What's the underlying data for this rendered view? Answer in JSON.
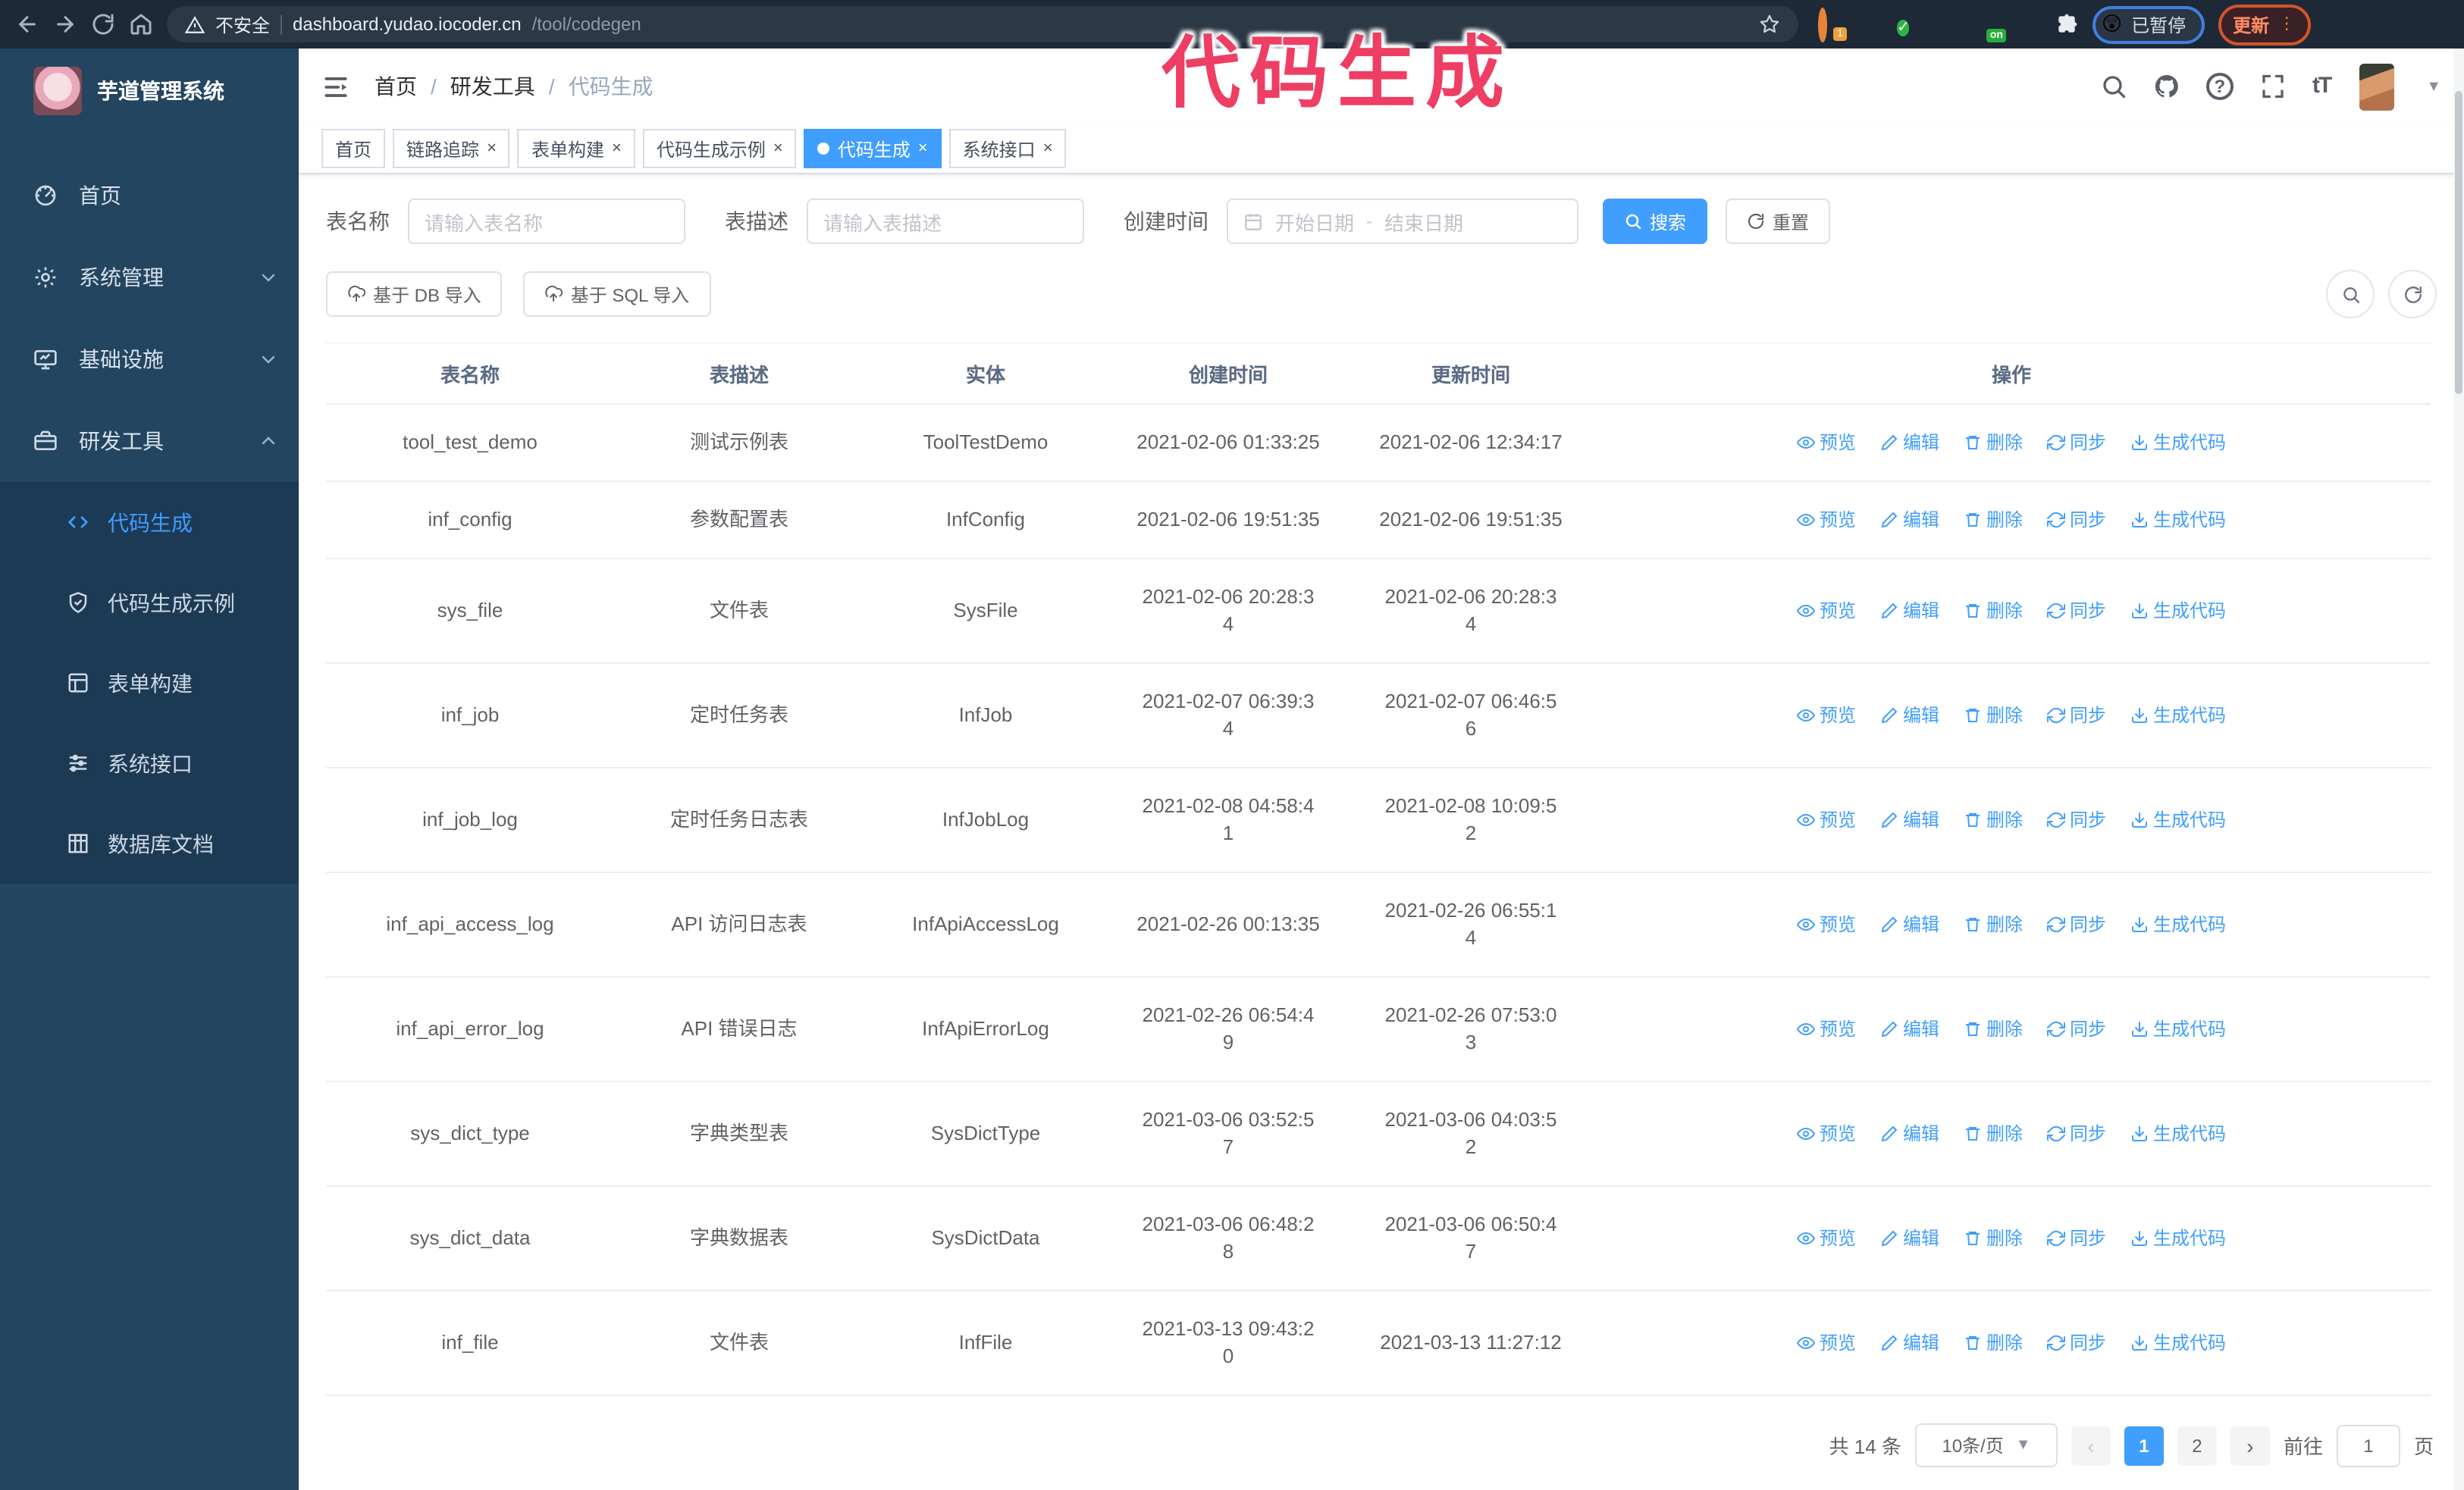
{
  "browser": {
    "security_label": "不安全",
    "url_host": "dashboard.yudao.iocoder.cn",
    "url_path": "/tool/codegen",
    "ext_badge_1": "1",
    "ext_badge_on": "on",
    "paused_emoji": "😲",
    "paused_label": "已暂停",
    "update_label": "更新",
    "update_dots": "⋮"
  },
  "annotation": {
    "text": "代码生成",
    "color": "#ee3e63"
  },
  "sidebar": {
    "title": "芋道管理系统",
    "items": [
      {
        "label": "首页",
        "icon": "dashboard-icon",
        "chevron": ""
      },
      {
        "label": "系统管理",
        "icon": "gear-icon",
        "chevron": "down"
      },
      {
        "label": "基础设施",
        "icon": "monitor-icon",
        "chevron": "down"
      },
      {
        "label": "研发工具",
        "icon": "toolbox-icon",
        "chevron": "up"
      }
    ],
    "submenu": [
      {
        "label": "代码生成",
        "icon": "code-icon",
        "active": true
      },
      {
        "label": "代码生成示例",
        "icon": "shield-check-icon",
        "active": false
      },
      {
        "label": "表单构建",
        "icon": "form-icon",
        "active": false
      },
      {
        "label": "系统接口",
        "icon": "sliders-icon",
        "active": false
      },
      {
        "label": "数据库文档",
        "icon": "columns-icon",
        "active": false
      }
    ]
  },
  "header": {
    "breadcrumb": [
      "首页",
      "研发工具",
      "代码生成"
    ],
    "text_size_label": "tT"
  },
  "tabs": [
    {
      "label": "首页",
      "closable": false,
      "active": false
    },
    {
      "label": "链路追踪",
      "closable": true,
      "active": false
    },
    {
      "label": "表单构建",
      "closable": true,
      "active": false
    },
    {
      "label": "代码生成示例",
      "closable": true,
      "active": false
    },
    {
      "label": "代码生成",
      "closable": true,
      "active": true
    },
    {
      "label": "系统接口",
      "closable": true,
      "active": false
    }
  ],
  "filters": {
    "table_name_label": "表名称",
    "table_name_placeholder": "请输入表名称",
    "table_desc_label": "表描述",
    "table_desc_placeholder": "请输入表描述",
    "create_time_label": "创建时间",
    "date_start_placeholder": "开始日期",
    "date_separator": "-",
    "date_end_placeholder": "结束日期",
    "search_label": "搜索",
    "reset_label": "重置"
  },
  "toolbar": {
    "import_db_label": "基于 DB 导入",
    "import_sql_label": "基于 SQL 导入"
  },
  "table": {
    "columns": [
      "表名称",
      "表描述",
      "实体",
      "创建时间",
      "更新时间",
      "操作"
    ],
    "actions": [
      {
        "label": "预览",
        "icon": "eye-icon"
      },
      {
        "label": "编辑",
        "icon": "edit-icon"
      },
      {
        "label": "删除",
        "icon": "delete-icon"
      },
      {
        "label": "同步",
        "icon": "sync-icon"
      },
      {
        "label": "生成代码",
        "icon": "generate-icon"
      }
    ],
    "rows": [
      {
        "name": "tool_test_demo",
        "desc": "测试示例表",
        "entity": "ToolTestDemo",
        "created": "2021-02-06 01:33:25",
        "updated": "2021-02-06 12:34:17"
      },
      {
        "name": "inf_config",
        "desc": "参数配置表",
        "entity": "InfConfig",
        "created": "2021-02-06 19:51:35",
        "updated": "2021-02-06 19:51:35"
      },
      {
        "name": "sys_file",
        "desc": "文件表",
        "entity": "SysFile",
        "created": "2021-02-06 20:28:3\n4",
        "updated": "2021-02-06 20:28:3\n4"
      },
      {
        "name": "inf_job",
        "desc": "定时任务表",
        "entity": "InfJob",
        "created": "2021-02-07 06:39:3\n4",
        "updated": "2021-02-07 06:46:5\n6"
      },
      {
        "name": "inf_job_log",
        "desc": "定时任务日志表",
        "entity": "InfJobLog",
        "created": "2021-02-08 04:58:4\n1",
        "updated": "2021-02-08 10:09:5\n2"
      },
      {
        "name": "inf_api_access_log",
        "desc": "API 访问日志表",
        "entity": "InfApiAccessLog",
        "created": "2021-02-26 00:13:35",
        "updated": "2021-02-26 06:55:1\n4"
      },
      {
        "name": "inf_api_error_log",
        "desc": "API 错误日志",
        "entity": "InfApiErrorLog",
        "created": "2021-02-26 06:54:4\n9",
        "updated": "2021-02-26 07:53:0\n3"
      },
      {
        "name": "sys_dict_type",
        "desc": "字典类型表",
        "entity": "SysDictType",
        "created": "2021-03-06 03:52:5\n7",
        "updated": "2021-03-06 04:03:5\n2"
      },
      {
        "name": "sys_dict_data",
        "desc": "字典数据表",
        "entity": "SysDictData",
        "created": "2021-03-06 06:48:2\n8",
        "updated": "2021-03-06 06:50:4\n7"
      },
      {
        "name": "inf_file",
        "desc": "文件表",
        "entity": "InfFile",
        "created": "2021-03-13 09:43:2\n0",
        "updated": "2021-03-13 11:27:12"
      }
    ]
  },
  "pagination": {
    "total": "共 14 条",
    "page_size": "10条/页",
    "pages": [
      "1",
      "2"
    ],
    "active_page": "1",
    "goto_label": "前往",
    "goto_value": "1",
    "goto_suffix": "页"
  },
  "colors": {
    "accent": "#409eff",
    "sidebar_bg": "#234560",
    "submenu_bg": "#1d3a55",
    "annotation": "#ee3e63"
  }
}
